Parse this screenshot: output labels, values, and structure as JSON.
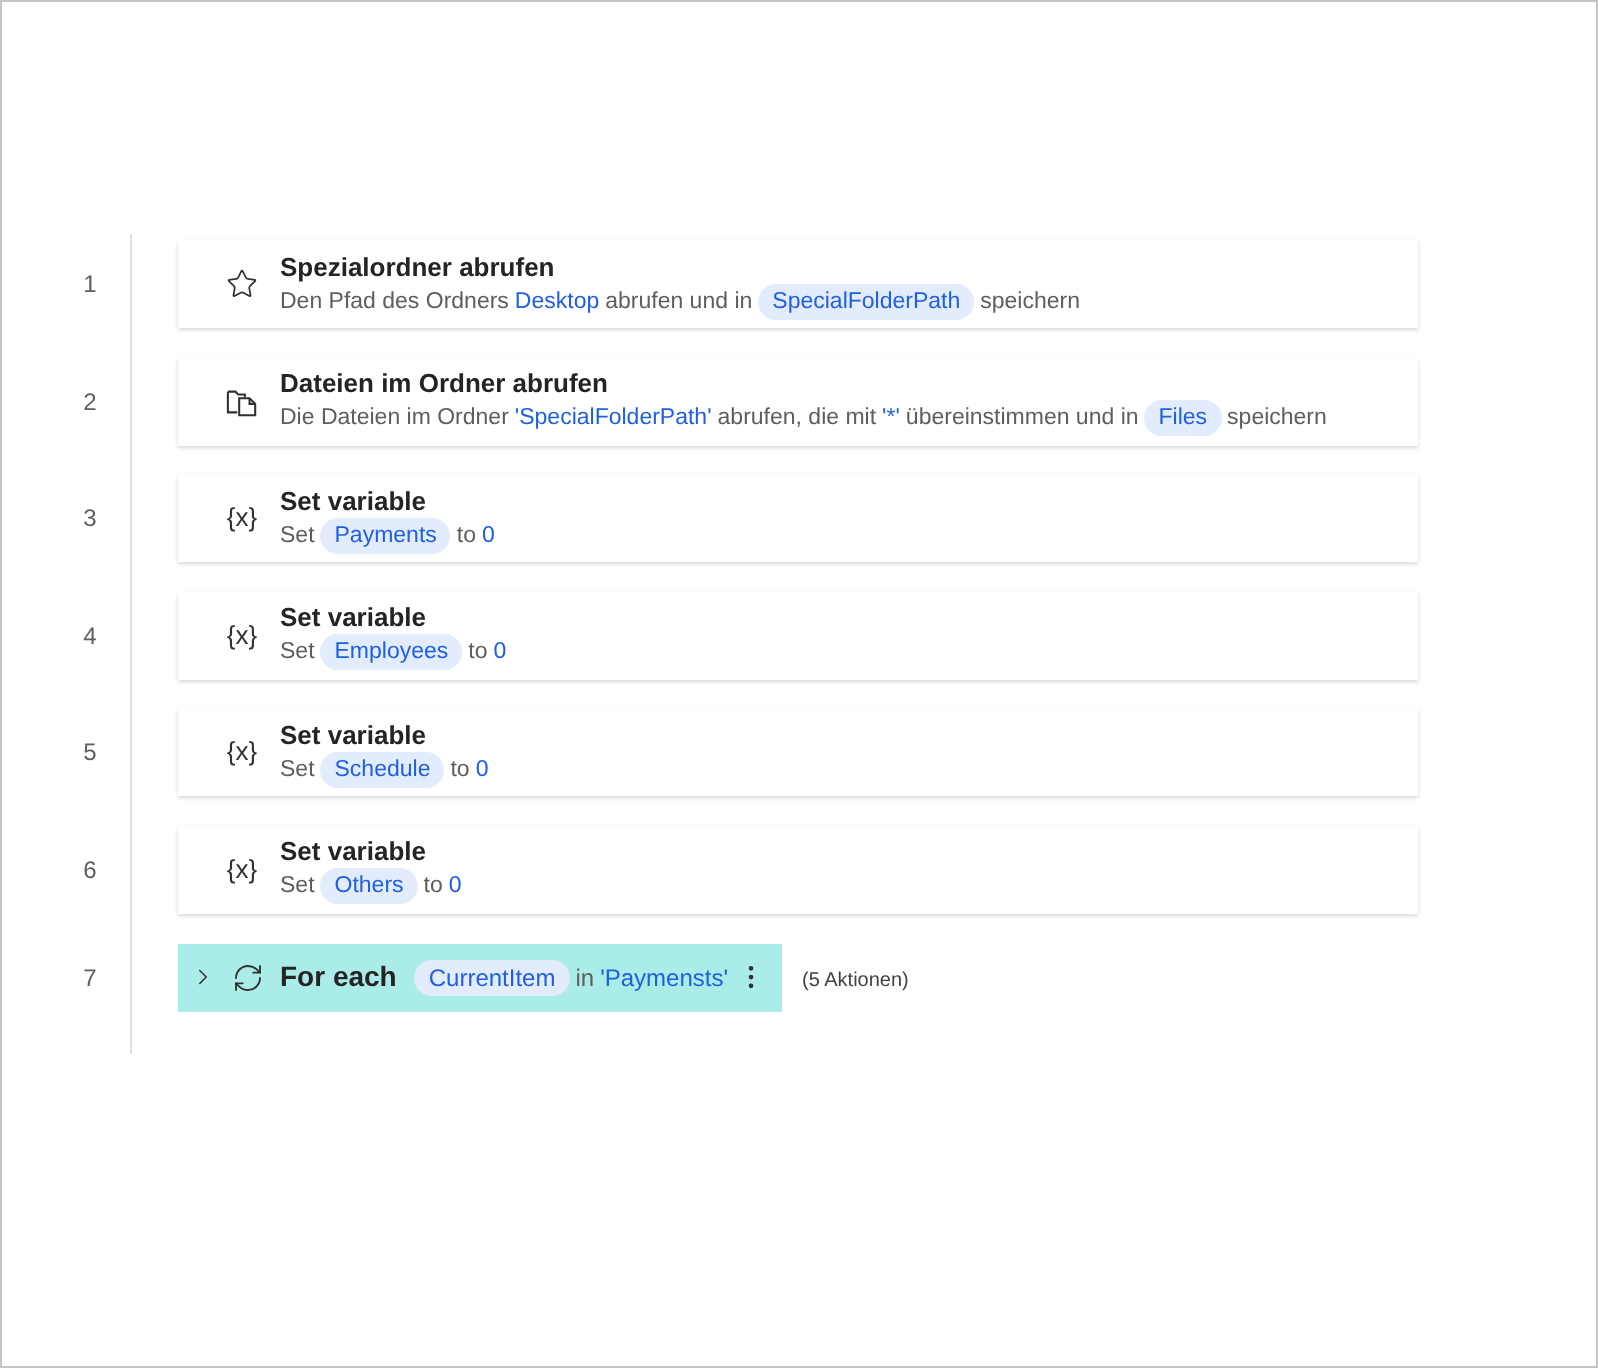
{
  "actions": [
    {
      "number": "1",
      "kind": "get-special-folder",
      "selected": false,
      "title": "Spezialordner abrufen",
      "description": [
        {
          "kind": "text",
          "text": "Den Pfad des Ordners"
        },
        {
          "kind": "value",
          "text": "Desktop"
        },
        {
          "kind": "text",
          "text": "abrufen und in"
        },
        {
          "kind": "variable",
          "text": "SpecialFolderPath"
        },
        {
          "kind": "text",
          "text": "speichern"
        }
      ]
    },
    {
      "number": "2",
      "kind": "get-files",
      "selected": false,
      "title": "Dateien im Ordner abrufen",
      "description": [
        {
          "kind": "text",
          "text": "Die Dateien im Ordner"
        },
        {
          "kind": "value",
          "text": "'SpecialFolderPath'"
        },
        {
          "kind": "text",
          "text": "abrufen, die mit"
        },
        {
          "kind": "value",
          "text": "'*'"
        },
        {
          "kind": "text",
          "text": "übereinstimmen und in"
        },
        {
          "kind": "variable",
          "text": "Files"
        },
        {
          "kind": "text",
          "text": "speichern"
        }
      ]
    },
    {
      "number": "3",
      "kind": "set-variable",
      "glyph": "{x}",
      "selected": false,
      "title": "Set variable",
      "description": [
        {
          "kind": "text",
          "text": "Set"
        },
        {
          "kind": "variable",
          "text": "Payments"
        },
        {
          "kind": "text",
          "text": "to"
        },
        {
          "kind": "value",
          "text": "0"
        }
      ]
    },
    {
      "number": "4",
      "kind": "set-variable",
      "glyph": "{x}",
      "selected": false,
      "title": "Set variable",
      "description": [
        {
          "kind": "text",
          "text": "Set"
        },
        {
          "kind": "variable",
          "text": "Employees"
        },
        {
          "kind": "text",
          "text": "to"
        },
        {
          "kind": "value",
          "text": "0"
        }
      ]
    },
    {
      "number": "5",
      "kind": "set-variable",
      "glyph": "{x}",
      "selected": false,
      "title": "Set variable",
      "description": [
        {
          "kind": "text",
          "text": "Set"
        },
        {
          "kind": "variable",
          "text": "Schedule"
        },
        {
          "kind": "text",
          "text": "to"
        },
        {
          "kind": "value",
          "text": "0"
        }
      ]
    },
    {
      "number": "6",
      "kind": "set-variable",
      "glyph": "{x}",
      "selected": false,
      "title": "Set variable",
      "description": [
        {
          "kind": "text",
          "text": "Set"
        },
        {
          "kind": "variable",
          "text": "Others"
        },
        {
          "kind": "text",
          "text": "to"
        },
        {
          "kind": "value",
          "text": "0"
        }
      ]
    },
    {
      "number": "7",
      "kind": "for-each",
      "selected": true,
      "expanded": false,
      "title": "For each",
      "description": [
        {
          "kind": "variable",
          "text": "CurrentItem"
        },
        {
          "kind": "text",
          "text": "in"
        },
        {
          "kind": "value",
          "text": "'Paymensts'"
        }
      ],
      "count": "(5 Aktionen)"
    }
  ]
}
